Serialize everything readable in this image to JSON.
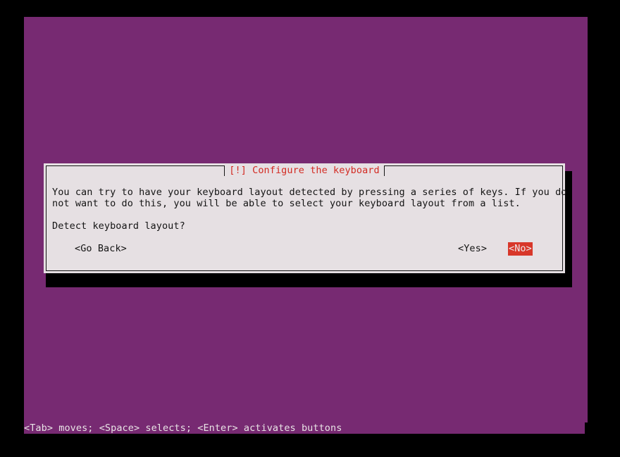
{
  "screen": {
    "background_color": "#000000",
    "terminal_background_color": "#772a72"
  },
  "dialog": {
    "title": "[!] Configure the keyboard",
    "title_color": "#d32a22",
    "background_color": "#e6e0e3",
    "border_color": "#151515",
    "body": {
      "line_1": "You can try to have your keyboard layout detected by pressing a series of keys. If you do",
      "line_2": "not want to do this, you will be able to select your keyboard layout from a list.",
      "prompt": "Detect keyboard layout?"
    },
    "buttons": {
      "go_back": "<Go Back>",
      "yes": "<Yes>",
      "no": "<No>",
      "selected": "<No>",
      "selected_background_color": "#d8372a",
      "selected_text_color": "#ede9eb"
    }
  },
  "status_bar": {
    "text": "<Tab> moves; <Space> selects; <Enter> activates buttons",
    "text_color": "#e9e4e6",
    "background_color": "#772a72"
  }
}
